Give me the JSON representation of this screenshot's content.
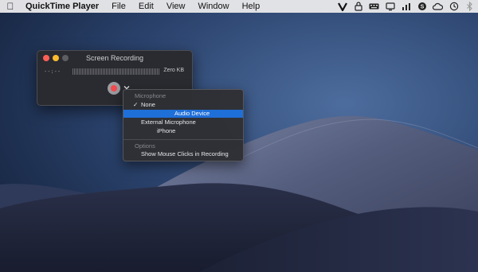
{
  "menubar": {
    "apple_icon": "apple-logo-icon",
    "items": [
      "QuickTime Player",
      "File",
      "Edit",
      "View",
      "Window",
      "Help"
    ],
    "status_icons": [
      "vimeo-icon",
      "lock-icon",
      "keyboard-icon",
      "display-icon",
      "bars-icon",
      "skype-icon",
      "cloud-icon",
      "time-machine-icon",
      "bluetooth-icon"
    ]
  },
  "window": {
    "title": "Screen Recording",
    "timer": "--:--",
    "size": "Zero KB"
  },
  "menu": {
    "microphone_header": "Microphone",
    "checkmark": "✓",
    "items": [
      "None",
      "Audio Device",
      "External Microphone",
      "iPhone"
    ],
    "selected_index": 0,
    "highlighted_index": 1,
    "options_header": "Options",
    "show_clicks": "Show Mouse Clicks in Recording"
  },
  "colors": {
    "highlight": "#1f6fd9",
    "record": "#f34b4f",
    "close": "#fe5f57",
    "minimize": "#febc2e"
  }
}
